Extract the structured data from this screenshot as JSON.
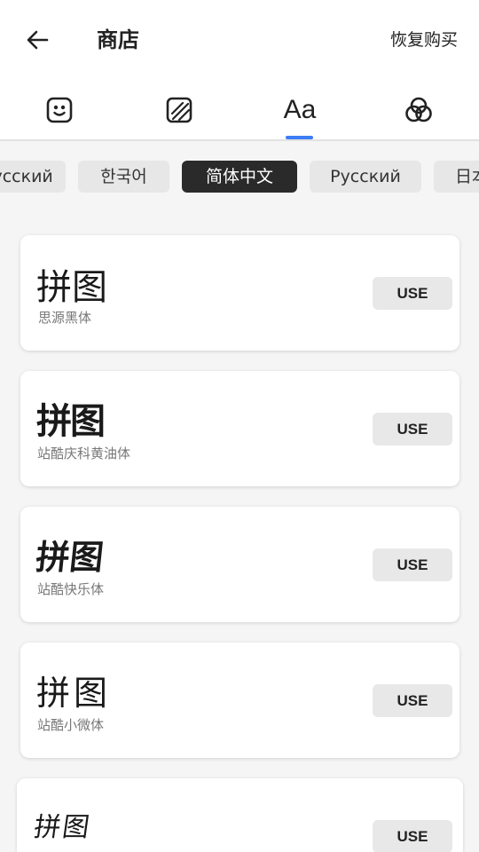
{
  "header": {
    "title": "商店",
    "restore_label": "恢复购买"
  },
  "tabs": [
    {
      "name": "sticker-tab",
      "icon": "smiley-icon"
    },
    {
      "name": "pattern-tab",
      "icon": "striped-square-icon"
    },
    {
      "name": "font-tab",
      "label": "Aa",
      "active": true
    },
    {
      "name": "filter-tab",
      "icon": "overlapping-circles-icon"
    }
  ],
  "languages": [
    "Русский",
    "한국어",
    "简体中文",
    "Русский",
    "日本語"
  ],
  "active_language": "简体中文",
  "fonts": [
    {
      "preview": "拼图",
      "name": "思源黑体",
      "button": "USE"
    },
    {
      "preview": "拼图",
      "name": "站酷庆科黄油体",
      "button": "USE"
    },
    {
      "preview": "拼图",
      "name": "站酷快乐体",
      "button": "USE"
    },
    {
      "preview": "拼图",
      "name": "站酷小微体",
      "button": "USE"
    },
    {
      "preview": "拼图",
      "name": "",
      "button": "USE"
    }
  ],
  "colors": {
    "accent": "#3d7cf5",
    "active_chip": "#2a2a2a",
    "chip": "#e7e7e7",
    "background": "#f5f5f5"
  }
}
